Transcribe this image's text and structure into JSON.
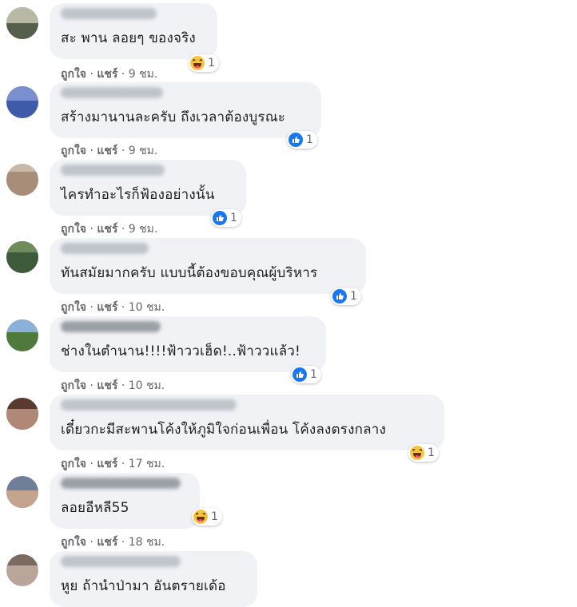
{
  "labels": {
    "like": "ถูกใจ",
    "share": "แชร์",
    "sep": "·"
  },
  "comments": [
    {
      "text": "สะ พาน ลอยๆ ของจริง",
      "time": "9 ชม.",
      "reaction": "haha",
      "count": "1"
    },
    {
      "text": "สร้างมานานละครับ ถึงเวลาต้องบูรณะ",
      "time": "9 ชม.",
      "reaction": "like",
      "count": "1"
    },
    {
      "text": "ไครทำอะไรก็ฟ้องอย่างนั้น",
      "time": "9 ชม.",
      "reaction": "like",
      "count": "1"
    },
    {
      "text": "ทันสมัยมากครับ แบบนี้ต้องขอบคุณผู้บริหาร",
      "time": "10 ชม.",
      "reaction": "like",
      "count": "1"
    },
    {
      "text": "ช่างในตำนาน!!!!ฟ้าววเฮ็ด!..ฟ้าววแล้ว!",
      "time": "10 ชม.",
      "reaction": "like",
      "count": "1"
    },
    {
      "text": "เดี๋ยวกะมีสะพานโค้งให้ภูมิใจก่อนเพื่อน โค้งลงตรงกลาง",
      "time": "17 ชม.",
      "reaction": "haha",
      "count": "1"
    },
    {
      "text": "ลอยอีหลี55",
      "time": "18 ชม.",
      "reaction": "haha",
      "count": "1"
    },
    {
      "text": "หูย ถ้านำป่ามา อันตรายเด้อ",
      "time": "",
      "reaction": "",
      "count": ""
    }
  ]
}
